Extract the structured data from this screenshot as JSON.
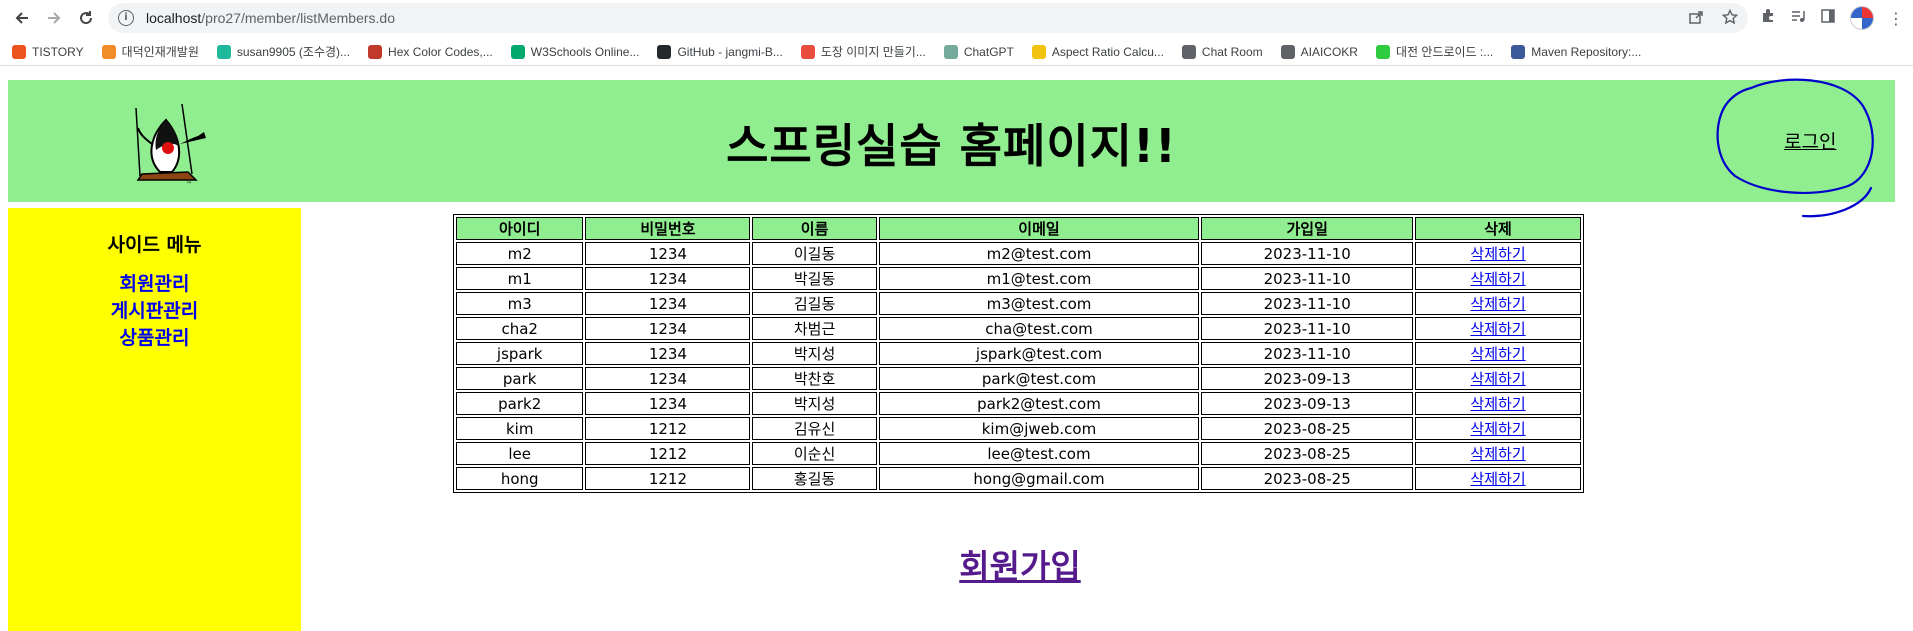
{
  "browser": {
    "url_host": "localhost",
    "url_path": "/pro27/member/listMembers.do"
  },
  "bookmarks": [
    {
      "label": "TISTORY",
      "color": "#eb531f"
    },
    {
      "label": "대덕인재개발원",
      "color": "#f28c28"
    },
    {
      "label": "susan9905 (조수경)...",
      "color": "#1fb89a"
    },
    {
      "label": "Hex Color Codes,...",
      "color": "#c0392b"
    },
    {
      "label": "W3Schools Online...",
      "color": "#04aa6d"
    },
    {
      "label": "GitHub - jangmi-B...",
      "color": "#24292e"
    },
    {
      "label": "도장 이미지 만들기...",
      "color": "#e74c3c"
    },
    {
      "label": "ChatGPT",
      "color": "#74aa9c"
    },
    {
      "label": "Aspect Ratio Calcu...",
      "color": "#f1c40f"
    },
    {
      "label": "Chat Room",
      "color": "#5f6368"
    },
    {
      "label": "AIAICOKR",
      "color": "#5f6368"
    },
    {
      "label": "대전 안드로이드 :...",
      "color": "#2ecc40"
    },
    {
      "label": "Maven Repository:...",
      "color": "#3b5998"
    }
  ],
  "header": {
    "title": "스프링실습 홈페이지!!",
    "login_label": "로그인"
  },
  "sidebar": {
    "title": "사이드 메뉴",
    "links": [
      "회원관리",
      "게시판관리",
      "상품관리"
    ]
  },
  "table": {
    "columns": [
      "아이디",
      "비밀번호",
      "이름",
      "이메일",
      "가입일",
      "삭제"
    ],
    "rows": [
      [
        "m2",
        "1234",
        "이길동",
        "m2@test.com",
        "2023-11-10",
        "삭제하기"
      ],
      [
        "m1",
        "1234",
        "박길동",
        "m1@test.com",
        "2023-11-10",
        "삭제하기"
      ],
      [
        "m3",
        "1234",
        "김길동",
        "m3@test.com",
        "2023-11-10",
        "삭제하기"
      ],
      [
        "cha2",
        "1234",
        "차범근",
        "cha@test.com",
        "2023-11-10",
        "삭제하기"
      ],
      [
        "jspark",
        "1234",
        "박지성",
        "jspark@test.com",
        "2023-11-10",
        "삭제하기"
      ],
      [
        "park",
        "1234",
        "박찬호",
        "park@test.com",
        "2023-09-13",
        "삭제하기"
      ],
      [
        "park2",
        "1234",
        "박지성",
        "park2@test.com",
        "2023-09-13",
        "삭제하기"
      ],
      [
        "kim",
        "1212",
        "김유신",
        "kim@jweb.com",
        "2023-08-25",
        "삭제하기"
      ],
      [
        "lee",
        "1212",
        "이순신",
        "lee@test.com",
        "2023-08-25",
        "삭제하기"
      ],
      [
        "hong",
        "1212",
        "홍길동",
        "hong@gmail.com",
        "2023-08-25",
        "삭제하기"
      ]
    ]
  },
  "join_label": "회원가입",
  "colors": {
    "header_bg": "#90ee90",
    "sidebar_bg": "#ffff00",
    "link": "#0000ee",
    "visited_link": "#551a8b",
    "annotation_circle": "#0000cc"
  }
}
